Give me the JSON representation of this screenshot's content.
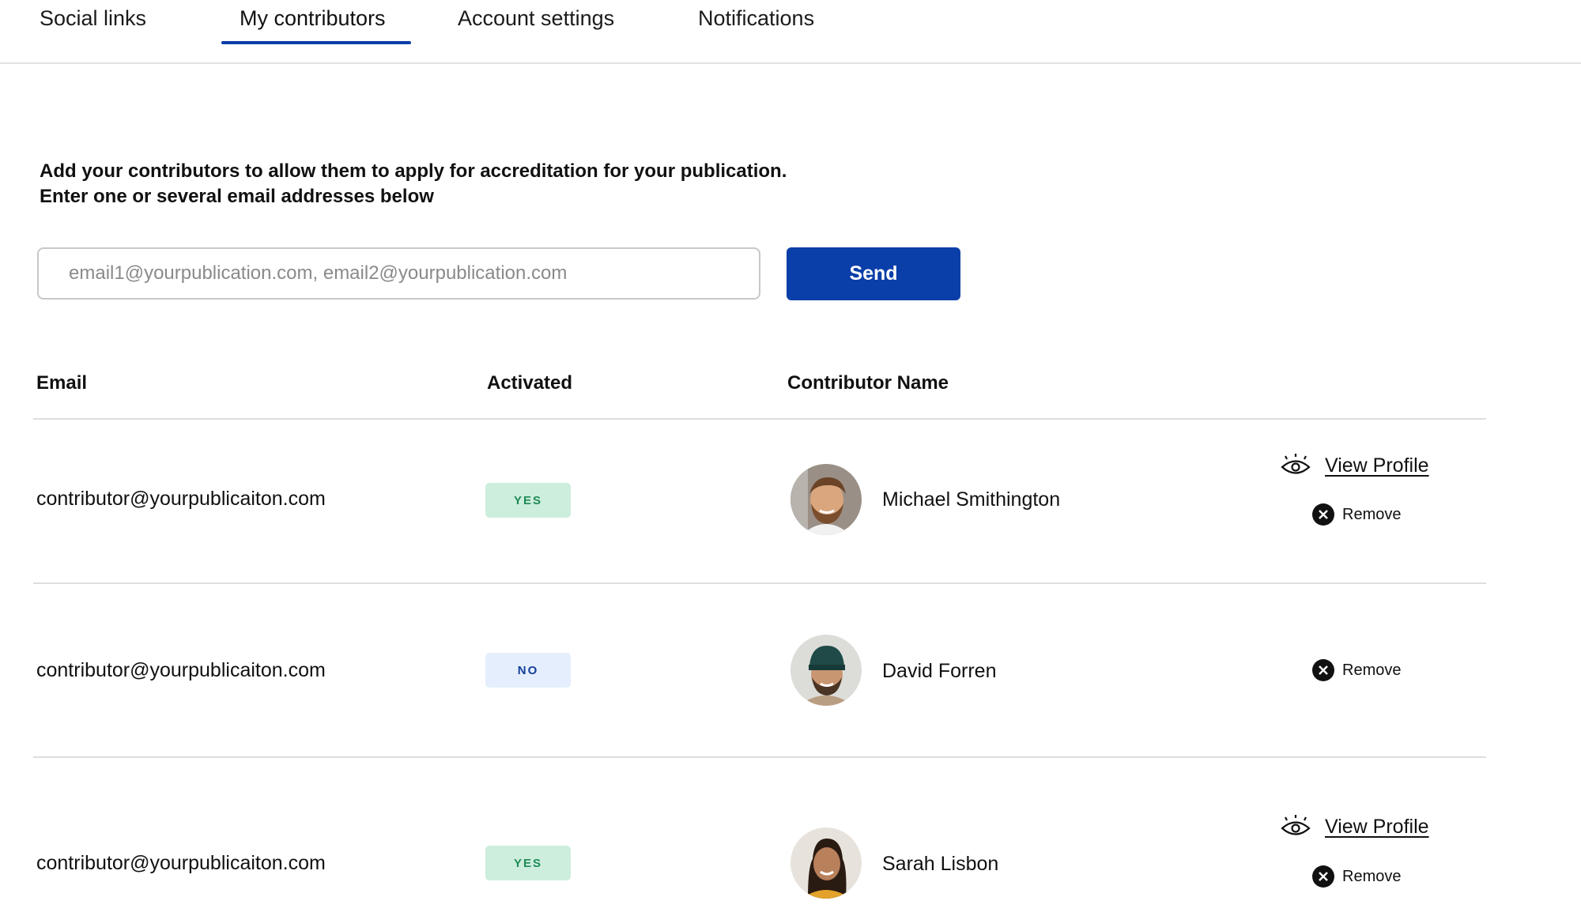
{
  "tabs": [
    {
      "label": "Social links",
      "active": false
    },
    {
      "label": "My contributors",
      "active": true
    },
    {
      "label": "Account settings",
      "active": false
    },
    {
      "label": "Notifications",
      "active": false
    }
  ],
  "intro": {
    "line1": "Add your contributors to allow them to apply for accreditation for your publication.",
    "line2": "Enter one or several email addresses below"
  },
  "invite": {
    "placeholder": "email1@yourpublication.com, email2@yourpublication.com",
    "value": "",
    "send_label": "Send"
  },
  "table": {
    "headers": [
      "Email",
      "Activated",
      "Contributor Name"
    ],
    "rows": [
      {
        "email": "contributor@yourpublicaiton.com",
        "activated": "YES",
        "name": "Michael Smithington",
        "view_profile": "View Profile",
        "remove": "Remove"
      },
      {
        "email": "contributor@yourpublicaiton.com",
        "activated": "NO",
        "name": "David Forren",
        "remove": "Remove"
      },
      {
        "email": "contributor@yourpublicaiton.com",
        "activated": "YES",
        "name": "Sarah Lisbon",
        "view_profile": "View Profile",
        "remove": "Remove"
      }
    ]
  },
  "icons": {
    "view": "eye-icon",
    "remove": "close-circle-icon",
    "avatar": "user-avatar"
  },
  "colors": {
    "accent": "#0a3ea8",
    "badge_yes_bg": "#cdeedd",
    "badge_yes_text": "#1f8a57",
    "badge_no_bg": "#e5eefc",
    "badge_no_text": "#123f9a"
  }
}
